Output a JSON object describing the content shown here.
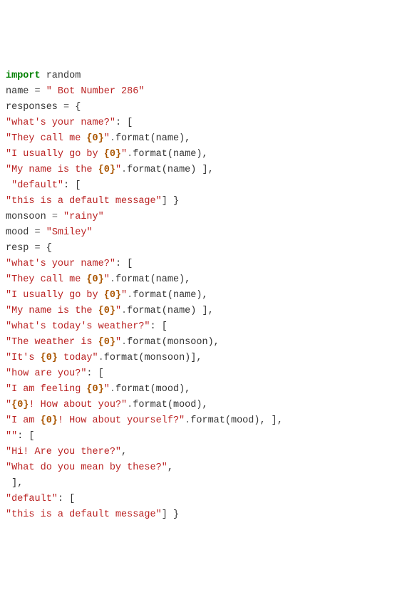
{
  "lines": [
    [
      [
        "kw",
        "import"
      ],
      [
        "py",
        " random"
      ]
    ],
    [
      [
        "id",
        "name "
      ],
      [
        "op",
        "="
      ],
      [
        "py",
        " "
      ],
      [
        "str",
        "\" Bot Number 286\""
      ]
    ],
    [
      [
        "id",
        "responses "
      ],
      [
        "op",
        "="
      ],
      [
        "py",
        " {"
      ]
    ],
    [
      [
        "str",
        "\"what's your name?\""
      ],
      [
        "py",
        ": ["
      ]
    ],
    [
      [
        "str",
        "\"They call me "
      ],
      [
        "fmt",
        "{0}"
      ],
      [
        "str",
        "\""
      ],
      [
        "op",
        "."
      ],
      [
        "id",
        "format"
      ],
      [
        "py",
        "(name),"
      ]
    ],
    [
      [
        "str",
        "\"I usually go by "
      ],
      [
        "fmt",
        "{0}"
      ],
      [
        "str",
        "\""
      ],
      [
        "op",
        "."
      ],
      [
        "id",
        "format"
      ],
      [
        "py",
        "(name),"
      ]
    ],
    [
      [
        "str",
        "\"My name is the "
      ],
      [
        "fmt",
        "{0}"
      ],
      [
        "str",
        "\""
      ],
      [
        "op",
        "."
      ],
      [
        "id",
        "format"
      ],
      [
        "py",
        "(name) ],"
      ]
    ],
    [
      [
        "py",
        " "
      ],
      [
        "str",
        "\"default\""
      ],
      [
        "py",
        ": ["
      ]
    ],
    [
      [
        "str",
        "\"this is a default message\""
      ],
      [
        "py",
        "] }"
      ]
    ],
    [
      [
        "id",
        "monsoon "
      ],
      [
        "op",
        "="
      ],
      [
        "py",
        " "
      ],
      [
        "str",
        "\"rainy\""
      ]
    ],
    [
      [
        "id",
        "mood "
      ],
      [
        "op",
        "="
      ],
      [
        "py",
        " "
      ],
      [
        "str",
        "\"Smiley\""
      ]
    ],
    [
      [
        "id",
        "resp "
      ],
      [
        "op",
        "="
      ],
      [
        "py",
        " {"
      ]
    ],
    [
      [
        "str",
        "\"what's your name?\""
      ],
      [
        "py",
        ": ["
      ]
    ],
    [
      [
        "str",
        "\"They call me "
      ],
      [
        "fmt",
        "{0}"
      ],
      [
        "str",
        "\""
      ],
      [
        "op",
        "."
      ],
      [
        "id",
        "format"
      ],
      [
        "py",
        "(name),"
      ]
    ],
    [
      [
        "str",
        "\"I usually go by "
      ],
      [
        "fmt",
        "{0}"
      ],
      [
        "str",
        "\""
      ],
      [
        "op",
        "."
      ],
      [
        "id",
        "format"
      ],
      [
        "py",
        "(name),"
      ]
    ],
    [
      [
        "str",
        "\"My name is the "
      ],
      [
        "fmt",
        "{0}"
      ],
      [
        "str",
        "\""
      ],
      [
        "op",
        "."
      ],
      [
        "id",
        "format"
      ],
      [
        "py",
        "(name) ],"
      ]
    ],
    [
      [
        "str",
        "\"what's today's weather?\""
      ],
      [
        "py",
        ": ["
      ]
    ],
    [
      [
        "str",
        "\"The weather is "
      ],
      [
        "fmt",
        "{0}"
      ],
      [
        "str",
        "\""
      ],
      [
        "op",
        "."
      ],
      [
        "id",
        "format"
      ],
      [
        "py",
        "(monsoon),"
      ]
    ],
    [
      [
        "str",
        "\"It's "
      ],
      [
        "fmt",
        "{0}"
      ],
      [
        "str",
        " today\""
      ],
      [
        "op",
        "."
      ],
      [
        "id",
        "format"
      ],
      [
        "py",
        "(monsoon)],"
      ]
    ],
    [
      [
        "py",
        ""
      ]
    ],
    [
      [
        "str",
        "\"how are you?\""
      ],
      [
        "py",
        ": ["
      ]
    ],
    [
      [
        "str",
        "\"I am feeling "
      ],
      [
        "fmt",
        "{0}"
      ],
      [
        "str",
        "\""
      ],
      [
        "op",
        "."
      ],
      [
        "id",
        "format"
      ],
      [
        "py",
        "(mood),"
      ]
    ],
    [
      [
        "str",
        "\""
      ],
      [
        "fmt",
        "{0}"
      ],
      [
        "str",
        "! How about you?\""
      ],
      [
        "op",
        "."
      ],
      [
        "id",
        "format"
      ],
      [
        "py",
        "(mood),"
      ]
    ],
    [
      [
        "str",
        "\"I am "
      ],
      [
        "fmt",
        "{0}"
      ],
      [
        "str",
        "! How about yourself?\""
      ],
      [
        "op",
        "."
      ],
      [
        "id",
        "format"
      ],
      [
        "py",
        "(mood), ],"
      ]
    ],
    [
      [
        "str",
        "\"\""
      ],
      [
        "py",
        ": ["
      ]
    ],
    [
      [
        "str",
        "\"Hi! Are you there?\""
      ],
      [
        "py",
        ","
      ]
    ],
    [
      [
        "str",
        "\"What do you mean by these?\""
      ],
      [
        "py",
        ","
      ]
    ],
    [
      [
        "py",
        " ],"
      ]
    ],
    [
      [
        "str",
        "\"default\""
      ],
      [
        "py",
        ": ["
      ]
    ],
    [
      [
        "str",
        "\"this is a default message\""
      ],
      [
        "py",
        "] }"
      ]
    ]
  ]
}
